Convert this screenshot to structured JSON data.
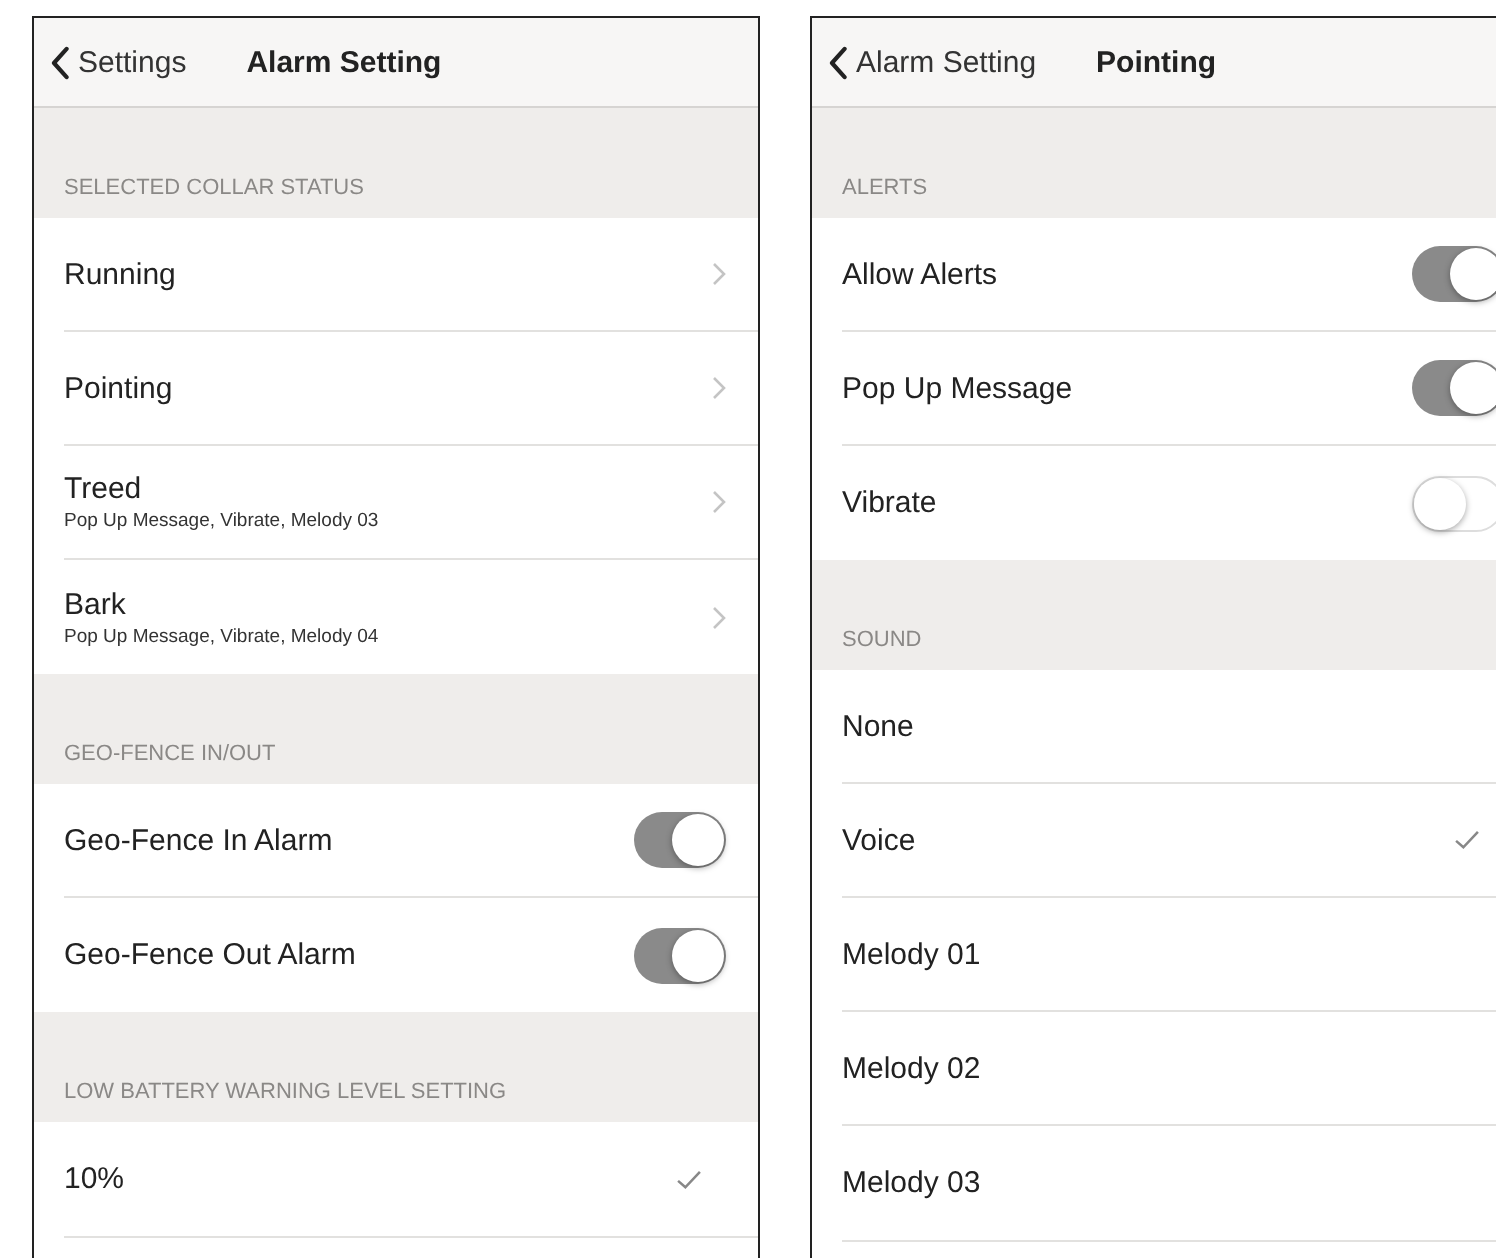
{
  "screens": [
    {
      "nav": {
        "back": "Settings",
        "title": "Alarm Setting"
      },
      "sections": [
        {
          "header": "SELECTED COLLAR STATUS",
          "rows": [
            {
              "kind": "link",
              "label": "Running"
            },
            {
              "kind": "link",
              "label": "Pointing"
            },
            {
              "kind": "link",
              "label": "Treed",
              "detail": "Pop Up Message, Vibrate, Melody 03"
            },
            {
              "kind": "link",
              "label": "Bark",
              "detail": "Pop Up Message, Vibrate, Melody 04"
            }
          ]
        },
        {
          "header": "GEO-FENCE IN/OUT",
          "rows": [
            {
              "kind": "toggle",
              "label": "Geo-Fence In Alarm",
              "on": true
            },
            {
              "kind": "toggle",
              "label": "Geo-Fence Out Alarm",
              "on": true
            }
          ]
        },
        {
          "header": "LOW BATTERY WARNING LEVEL SETTING",
          "rows": [
            {
              "kind": "choice",
              "label": "10%",
              "selected": true
            }
          ]
        }
      ]
    },
    {
      "nav": {
        "back": "Alarm Setting",
        "title": "Pointing"
      },
      "sections": [
        {
          "header": "ALERTS",
          "rows": [
            {
              "kind": "toggle",
              "label": "Allow Alerts",
              "on": true
            },
            {
              "kind": "toggle",
              "label": "Pop Up Message",
              "on": true
            },
            {
              "kind": "toggle",
              "label": "Vibrate",
              "on": false
            }
          ]
        },
        {
          "header": "SOUND",
          "rows": [
            {
              "kind": "choice",
              "label": "None",
              "selected": false
            },
            {
              "kind": "choice",
              "label": "Voice",
              "selected": true
            },
            {
              "kind": "choice",
              "label": "Melody 01",
              "selected": false
            },
            {
              "kind": "choice",
              "label": "Melody 02",
              "selected": false
            },
            {
              "kind": "choice",
              "label": "Melody 03",
              "selected": false
            }
          ]
        }
      ]
    }
  ]
}
